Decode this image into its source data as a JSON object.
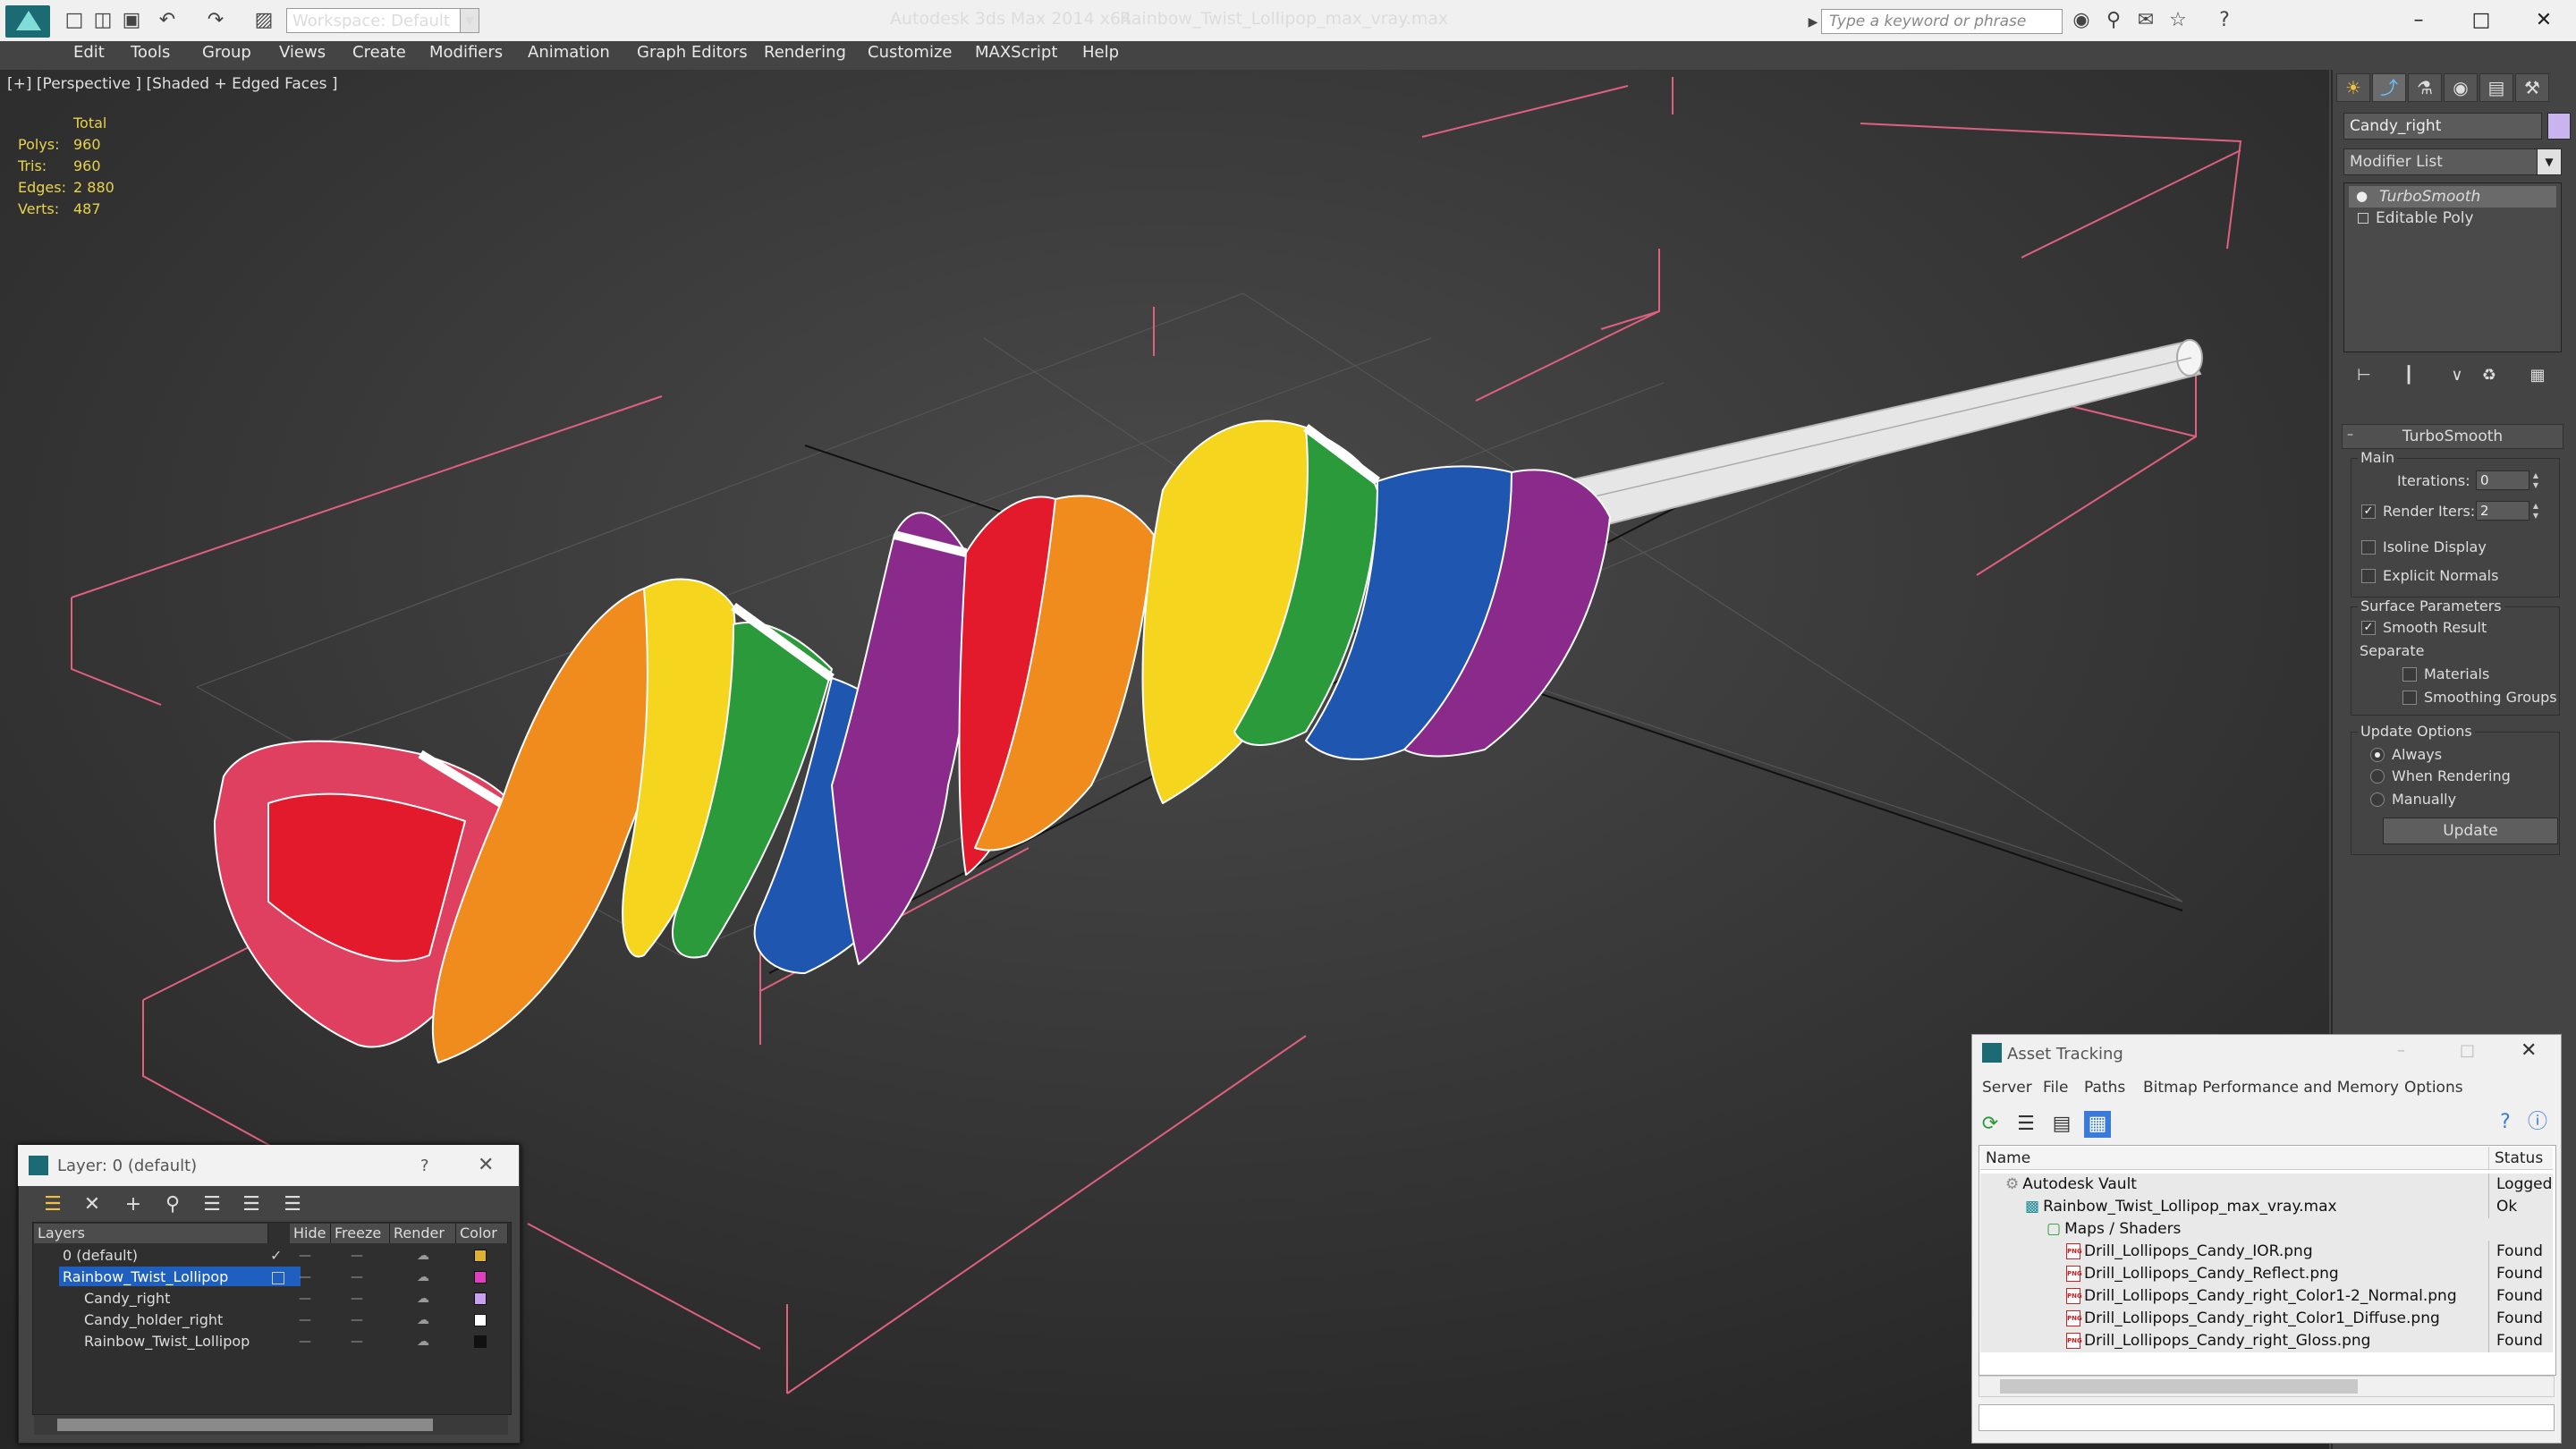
{
  "titlebar": {
    "app_title": "Autodesk 3ds Max  2014 x64",
    "file_title": "Rainbow_Twist_Lollipop_max_vray.max",
    "workspace": "Workspace: Default",
    "search_placeholder": "Type a keyword or phrase"
  },
  "menu": [
    "Edit",
    "Tools",
    "Group",
    "Views",
    "Create",
    "Modifiers",
    "Animation",
    "Graph Editors",
    "Rendering",
    "Customize",
    "MAXScript",
    "Help"
  ],
  "viewport": {
    "label": "[+] [Perspective ] [Shaded + Edged Faces ]",
    "stats": {
      "header": "Total",
      "rows": [
        {
          "label": "Polys:",
          "value": "960"
        },
        {
          "label": "Tris:",
          "value": "960"
        },
        {
          "label": "Edges:",
          "value": "2 880"
        },
        {
          "label": "Verts:",
          "value": "487"
        }
      ]
    }
  },
  "command_panel": {
    "object_name": "Candy_right",
    "object_color": "#c9b4f0",
    "modifier_list": "Modifier List",
    "stack": [
      "TurboSmooth",
      "Editable Poly"
    ],
    "rollout": "TurboSmooth",
    "main_group": "Main",
    "iterations_label": "Iterations:",
    "iterations_value": "0",
    "render_iters_label": "Render Iters:",
    "render_iters_value": "2",
    "isoline_label": "Isoline Display",
    "explicit_normals_label": "Explicit Normals",
    "surface_group": "Surface Parameters",
    "smooth_result_label": "Smooth Result",
    "separate_label": "Separate",
    "materials_label": "Materials",
    "smoothing_groups_label": "Smoothing Groups",
    "update_group": "Update Options",
    "always_label": "Always",
    "when_rendering_label": "When Rendering",
    "manually_label": "Manually",
    "update_button": "Update"
  },
  "layer_dialog": {
    "title": "Layer: 0 (default)",
    "help": "?",
    "columns": [
      "Layers",
      "Hide",
      "Freeze",
      "Render",
      "Color"
    ],
    "rows": [
      {
        "name": "0 (default)",
        "indent": 0,
        "selected": false,
        "color": "#e0b030",
        "active": true
      },
      {
        "name": "Rainbow_Twist_Lollipop",
        "indent": 0,
        "selected": true,
        "color": "#e040c0",
        "active": false
      },
      {
        "name": "Candy_right",
        "indent": 1,
        "selected": false,
        "color": "#c9a0f0",
        "active": false
      },
      {
        "name": "Candy_holder_right",
        "indent": 1,
        "selected": false,
        "color": "#ffffff",
        "active": false
      },
      {
        "name": "Rainbow_Twist_Lollipop",
        "indent": 1,
        "selected": false,
        "color": "#111111",
        "active": false
      }
    ]
  },
  "asset_dialog": {
    "title": "Asset Tracking",
    "menu": [
      "Server",
      "File",
      "Paths",
      "Bitmap Performance and Memory",
      "Options"
    ],
    "columns": [
      "Name",
      "Status"
    ],
    "rows": [
      {
        "name": "Autodesk Vault",
        "status": "Logged C",
        "level": 0,
        "icon": "vault"
      },
      {
        "name": "Rainbow_Twist_Lollipop_max_vray.max",
        "status": "Ok",
        "level": 1,
        "icon": "max"
      },
      {
        "name": "Maps / Shaders",
        "status": "",
        "level": 2,
        "icon": "maps"
      },
      {
        "name": "Drill_Lollipops_Candy_IOR.png",
        "status": "Found",
        "level": 3,
        "icon": "png"
      },
      {
        "name": "Drill_Lollipops_Candy_Reflect.png",
        "status": "Found",
        "level": 3,
        "icon": "png"
      },
      {
        "name": "Drill_Lollipops_Candy_right_Color1-2_Normal.png",
        "status": "Found",
        "level": 3,
        "icon": "png"
      },
      {
        "name": "Drill_Lollipops_Candy_right_Color1_Diffuse.png",
        "status": "Found",
        "level": 3,
        "icon": "png"
      },
      {
        "name": "Drill_Lollipops_Candy_right_Gloss.png",
        "status": "Found",
        "level": 3,
        "icon": "png"
      }
    ]
  }
}
